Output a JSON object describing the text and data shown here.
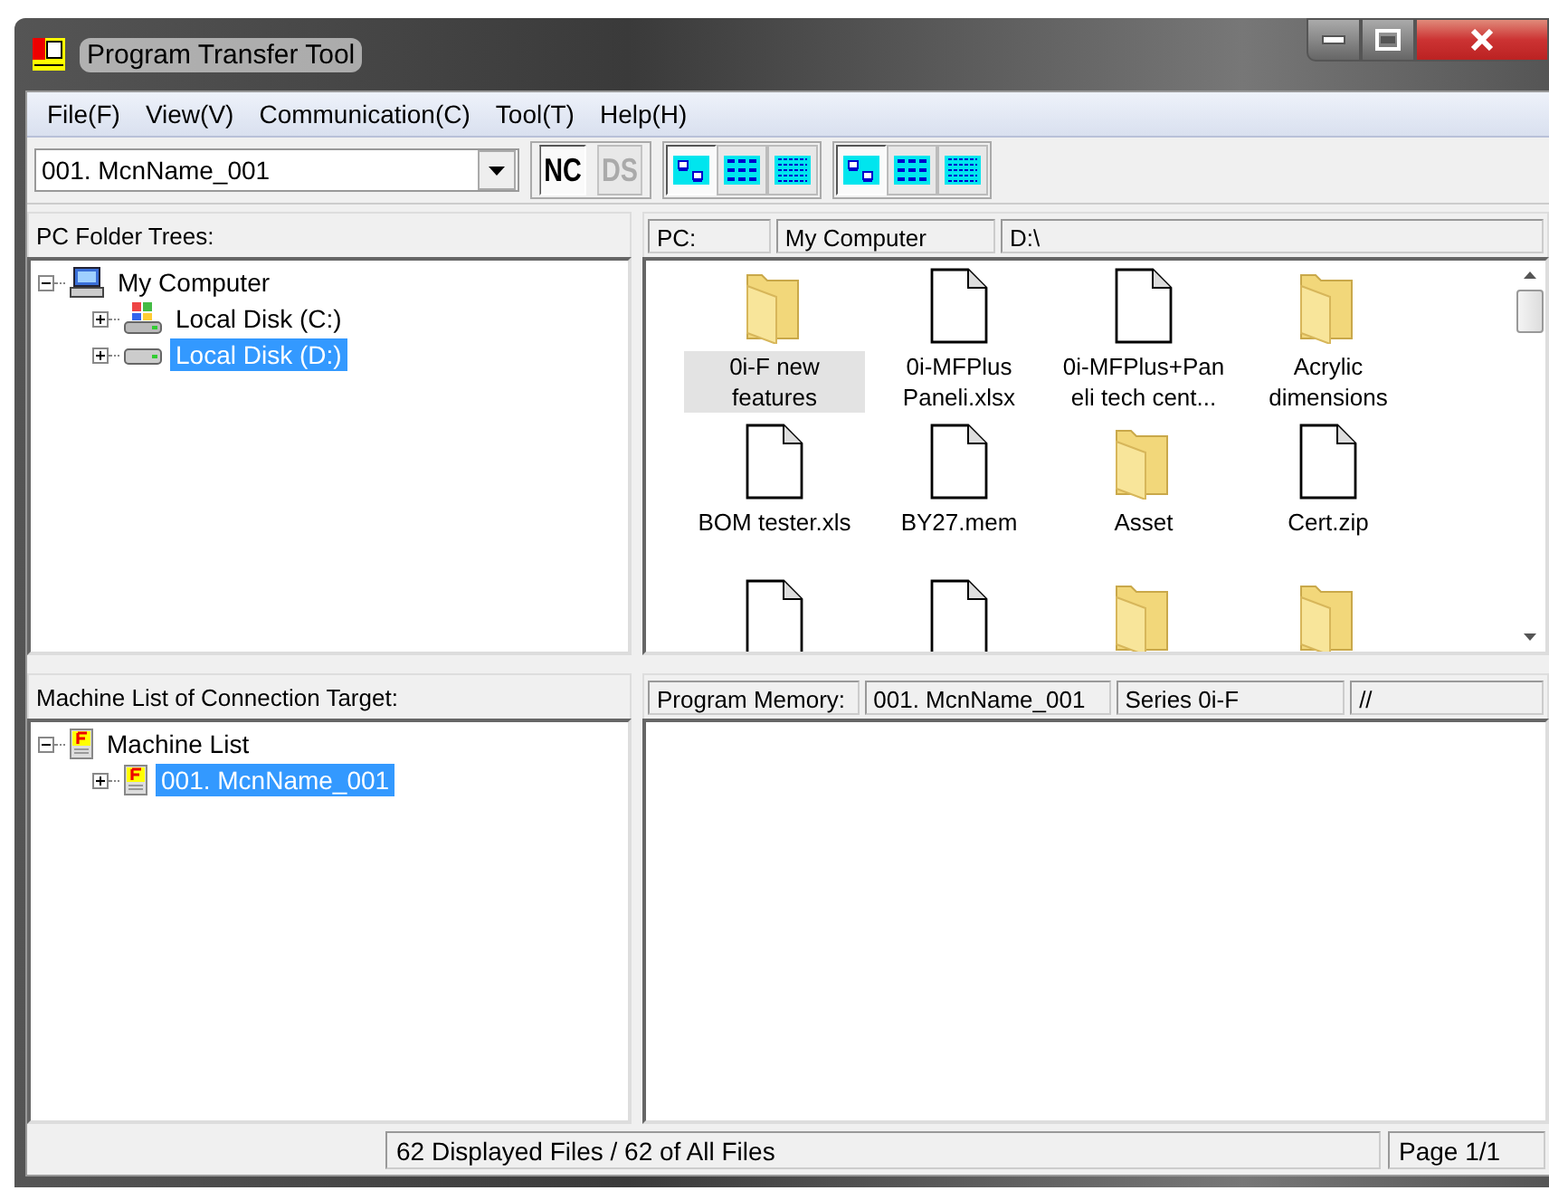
{
  "window": {
    "title": "Program Transfer Tool"
  },
  "menu": [
    "File(F)",
    "View(V)",
    "Communication(C)",
    "Tool(T)",
    "Help(H)"
  ],
  "toolbar": {
    "machine_select": {
      "value": "001. McnName_001"
    },
    "modes": [
      {
        "label": "NC",
        "disabled": false
      },
      {
        "label": "DS",
        "disabled": true
      }
    ],
    "view_groups": [
      [
        {
          "kind": "icons",
          "selected": true
        },
        {
          "kind": "list",
          "selected": false
        },
        {
          "kind": "details",
          "selected": false
        }
      ],
      [
        {
          "kind": "icons",
          "selected": true
        },
        {
          "kind": "list",
          "selected": false
        },
        {
          "kind": "details",
          "selected": false
        }
      ]
    ]
  },
  "pc_tree": {
    "title": "PC Folder Trees:",
    "items": [
      {
        "label": "My Computer",
        "kind": "computer",
        "expanded": true,
        "selected": false,
        "children": [
          {
            "label": "Local Disk (C:)",
            "kind": "system-disk",
            "expanded": false,
            "selected": false
          },
          {
            "label": "Local Disk (D:)",
            "kind": "disk",
            "expanded": false,
            "selected": true
          }
        ]
      }
    ]
  },
  "pc_path": [
    "PC:",
    "My Computer",
    "D:\\"
  ],
  "files": [
    {
      "name": "0i-F new features",
      "kind": "folder",
      "focused": true
    },
    {
      "name": "0i-MFPlus Paneli.xlsx",
      "kind": "file",
      "focused": false
    },
    {
      "name": "0i-MFPlus+Pan eli tech cent...",
      "kind": "file",
      "focused": false
    },
    {
      "name": "Acrylic dimensions",
      "kind": "folder",
      "focused": false
    },
    {
      "name": "BOM tester.xls",
      "kind": "file",
      "focused": false
    },
    {
      "name": "BY27.mem",
      "kind": "file",
      "focused": false
    },
    {
      "name": "Asset",
      "kind": "folder",
      "focused": false
    },
    {
      "name": "Cert.zip",
      "kind": "file",
      "focused": false
    },
    {
      "kind": "file",
      "focused": false
    },
    {
      "kind": "file",
      "focused": false
    },
    {
      "kind": "folder",
      "focused": false
    },
    {
      "kind": "folder",
      "focused": false
    }
  ],
  "machine_tree": {
    "title": "Machine List of Connection Target:",
    "items": [
      {
        "label": "Machine List",
        "kind": "machine",
        "expanded": true,
        "selected": false,
        "children": [
          {
            "label": "001. McnName_001",
            "kind": "machine",
            "expanded": false,
            "selected": true
          }
        ]
      }
    ]
  },
  "memory_header": [
    "Program Memory:",
    "001. McnName_001",
    "Series 0i-F",
    "//"
  ],
  "status_bar": {
    "files": "62 Displayed Files / 62 of All Files",
    "page": "Page 1/1"
  }
}
